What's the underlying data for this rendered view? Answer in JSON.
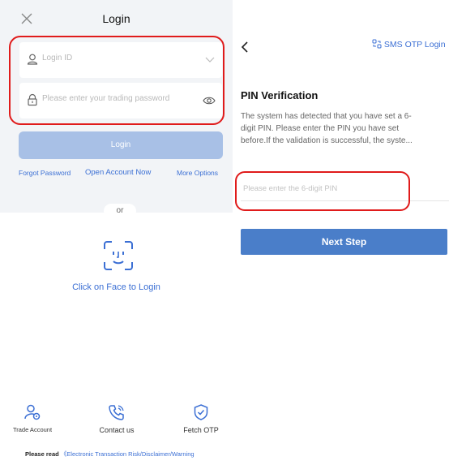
{
  "left": {
    "title": "Login",
    "login_id_placeholder": "Login ID",
    "password_placeholder": "Please enter your trading password",
    "login_button": "Login",
    "forgot_password": "Forgot Password",
    "open_account": "Open Account Now",
    "more_options": "More Options",
    "or_text": "or",
    "face_login": "Click on Face to Login",
    "bottom": [
      {
        "label": "Trade Account",
        "icon": "user-account-icon"
      },
      {
        "label": "Contact us",
        "icon": "phone-icon"
      },
      {
        "label": "Fetch OTP",
        "icon": "shield-check-icon"
      }
    ],
    "footer_prefix": "Please read",
    "footer_link": "《Electronic Transaction Risk/Disclaimer/Warning"
  },
  "right": {
    "sms_otp_login": "SMS OTP Login",
    "pin_title": "PIN Verification",
    "pin_desc_lines": [
      "The system has detected that you have set a 6-",
      "digit PIN. Please enter the PIN you have set",
      "before.If the validation is successful, the syste..."
    ],
    "pin_placeholder": "Please enter the 6-digit PIN",
    "next_step": "Next Step"
  },
  "colors": {
    "accent": "#3b6fd4",
    "button_disabled": "#a8c0e6",
    "button_primary": "#4a7ec9",
    "highlight": "#e01b1b"
  }
}
